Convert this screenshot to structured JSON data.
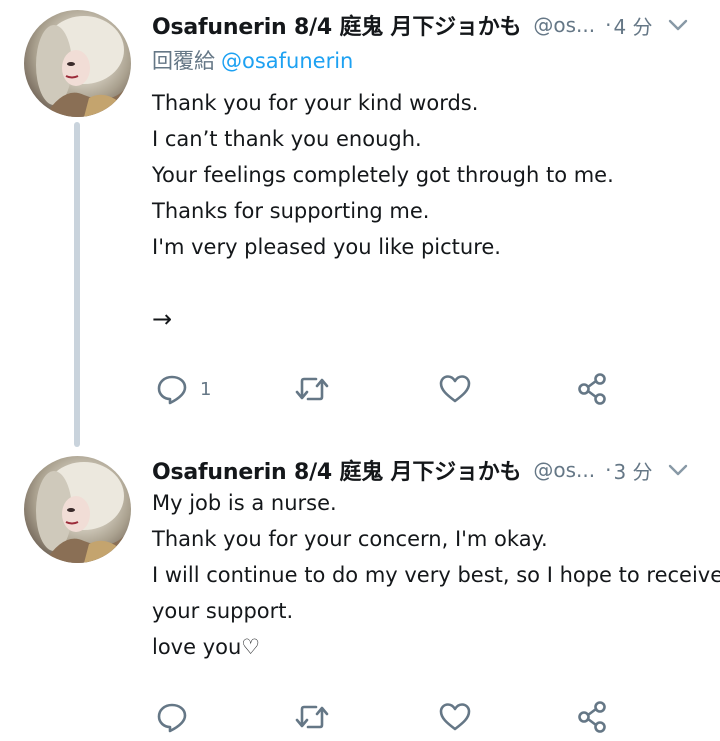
{
  "tweets": [
    {
      "display_name": "Osafunerin 8/4 庭鬼 月下ジョかも",
      "handle": "@os...",
      "separator": "·",
      "time": "4 分",
      "reply_prefix": "回覆給",
      "reply_mention": "@osafunerin",
      "lines": [
        "Thank you for your kind words.",
        "I can’t thank you enough.",
        "Your feelings completely got through to me.",
        "Thanks for supporting me.",
        "I'm very pleased you like picture."
      ],
      "trailing_symbol": "→",
      "reply_count": "1"
    },
    {
      "display_name": "Osafunerin 8/4 庭鬼 月下ジョかも",
      "handle": "@os...",
      "separator": "·",
      "time": "3 分",
      "lines": [
        "My job is a nurse.",
        "Thank you for your concern, I'm okay.",
        "I will continue to do my very best, so I hope to receive",
        "your support.",
        "love you♡"
      ]
    }
  ],
  "icons": {
    "reply": "reply-icon",
    "retweet": "retweet-icon",
    "like": "heart-icon",
    "share": "share-icon",
    "menu": "chevron-down-icon"
  },
  "colors": {
    "text": "#14171a",
    "secondary": "#657786",
    "link": "#1da1f2",
    "thread_line": "#c9d3dc"
  }
}
